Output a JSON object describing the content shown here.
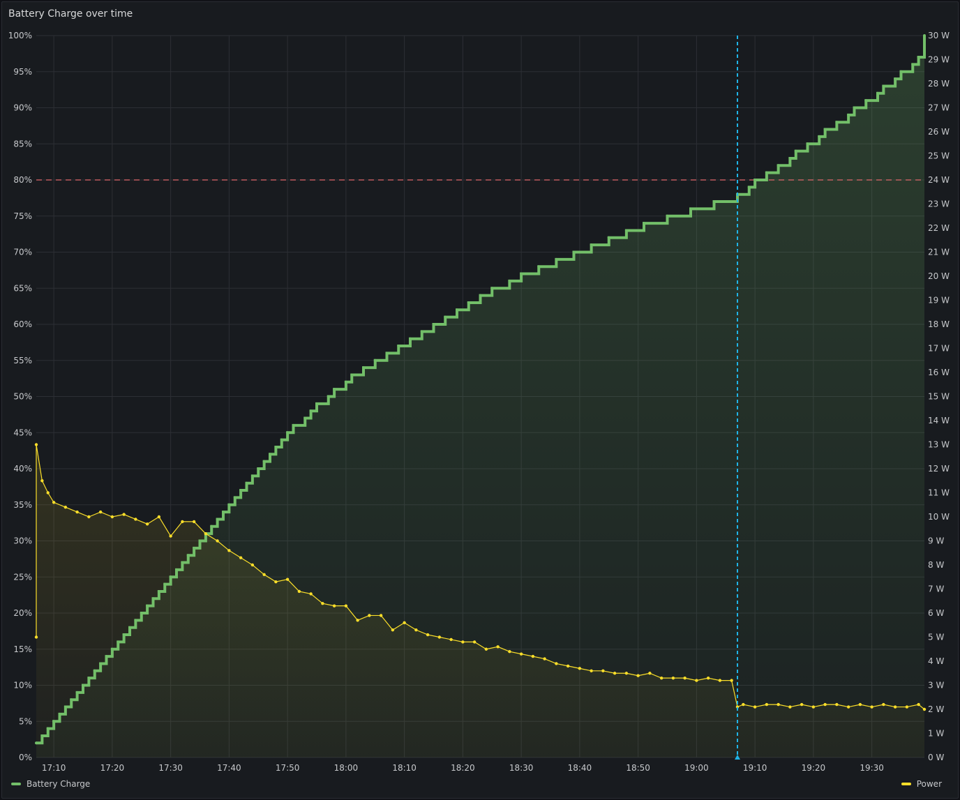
{
  "panel": {
    "title": "Battery Charge over time"
  },
  "colors": {
    "battery": "#73bf69",
    "power": "#fade2a",
    "threshold": "#e0676b",
    "cursor": "#1fb4e7",
    "grid": "#2c2f35"
  },
  "chart_data": {
    "type": "line",
    "title": "Battery Charge over time",
    "x_ticks": [
      "17:10",
      "17:20",
      "17:30",
      "17:40",
      "17:50",
      "18:00",
      "18:10",
      "18:20",
      "18:30",
      "18:40",
      "18:50",
      "19:00",
      "19:10",
      "19:20",
      "19:30"
    ],
    "x_range": [
      "17:07",
      "19:39"
    ],
    "y_left": {
      "unit": "%",
      "range": [
        0,
        100
      ],
      "ticks": [
        "0%",
        "5%",
        "10%",
        "15%",
        "20%",
        "25%",
        "30%",
        "35%",
        "40%",
        "45%",
        "50%",
        "55%",
        "60%",
        "65%",
        "70%",
        "75%",
        "80%",
        "85%",
        "90%",
        "95%",
        "100%"
      ]
    },
    "y_right": {
      "unit": "W",
      "range": [
        0,
        30
      ],
      "ticks": [
        "0 W",
        "1 W",
        "2 W",
        "3 W",
        "4 W",
        "5 W",
        "6 W",
        "7 W",
        "8 W",
        "9 W",
        "10 W",
        "11 W",
        "12 W",
        "13 W",
        "14 W",
        "15 W",
        "16 W",
        "17 W",
        "18 W",
        "19 W",
        "20 W",
        "21 W",
        "22 W",
        "23 W",
        "24 W",
        "25 W",
        "26 W",
        "27 W",
        "28 W",
        "29 W",
        "30 W"
      ]
    },
    "threshold": {
      "axis": "left",
      "value": 80,
      "style": "dashed"
    },
    "cursor_time": "19:07",
    "series": [
      {
        "name": "Battery Charge",
        "axis": "left",
        "interpolation": "step",
        "fill": true,
        "points": [
          [
            "17:07",
            2
          ],
          [
            "17:08",
            3
          ],
          [
            "17:09",
            4
          ],
          [
            "17:10",
            5
          ],
          [
            "17:11",
            6
          ],
          [
            "17:12",
            7
          ],
          [
            "17:13",
            8
          ],
          [
            "17:14",
            9
          ],
          [
            "17:15",
            10
          ],
          [
            "17:16",
            11
          ],
          [
            "17:17",
            12
          ],
          [
            "17:18",
            13
          ],
          [
            "17:19",
            14
          ],
          [
            "17:20",
            15
          ],
          [
            "17:21",
            16
          ],
          [
            "17:22",
            17
          ],
          [
            "17:23",
            18
          ],
          [
            "17:24",
            19
          ],
          [
            "17:25",
            20
          ],
          [
            "17:26",
            21
          ],
          [
            "17:27",
            22
          ],
          [
            "17:28",
            23
          ],
          [
            "17:29",
            24
          ],
          [
            "17:30",
            25
          ],
          [
            "17:31",
            26
          ],
          [
            "17:32",
            27
          ],
          [
            "17:33",
            28
          ],
          [
            "17:34",
            29
          ],
          [
            "17:35",
            30
          ],
          [
            "17:36",
            31
          ],
          [
            "17:37",
            32
          ],
          [
            "17:38",
            33
          ],
          [
            "17:39",
            34
          ],
          [
            "17:40",
            35
          ],
          [
            "17:41",
            36
          ],
          [
            "17:42",
            37
          ],
          [
            "17:43",
            38
          ],
          [
            "17:44",
            39
          ],
          [
            "17:45",
            40
          ],
          [
            "17:46",
            41
          ],
          [
            "17:47",
            42
          ],
          [
            "17:48",
            43
          ],
          [
            "17:49",
            44
          ],
          [
            "17:50",
            45
          ],
          [
            "17:51",
            46
          ],
          [
            "17:53",
            47
          ],
          [
            "17:54",
            48
          ],
          [
            "17:55",
            49
          ],
          [
            "17:57",
            50
          ],
          [
            "17:58",
            51
          ],
          [
            "18:00",
            52
          ],
          [
            "18:01",
            53
          ],
          [
            "18:03",
            54
          ],
          [
            "18:05",
            55
          ],
          [
            "18:07",
            56
          ],
          [
            "18:09",
            57
          ],
          [
            "18:11",
            58
          ],
          [
            "18:13",
            59
          ],
          [
            "18:15",
            60
          ],
          [
            "18:17",
            61
          ],
          [
            "18:19",
            62
          ],
          [
            "18:21",
            63
          ],
          [
            "18:23",
            64
          ],
          [
            "18:25",
            65
          ],
          [
            "18:28",
            66
          ],
          [
            "18:30",
            67
          ],
          [
            "18:33",
            68
          ],
          [
            "18:36",
            69
          ],
          [
            "18:39",
            70
          ],
          [
            "18:42",
            71
          ],
          [
            "18:45",
            72
          ],
          [
            "18:48",
            73
          ],
          [
            "18:51",
            74
          ],
          [
            "18:55",
            75
          ],
          [
            "18:59",
            76
          ],
          [
            "19:03",
            77
          ],
          [
            "19:07",
            78
          ],
          [
            "19:09",
            79
          ],
          [
            "19:10",
            80
          ],
          [
            "19:12",
            81
          ],
          [
            "19:14",
            82
          ],
          [
            "19:16",
            83
          ],
          [
            "19:17",
            84
          ],
          [
            "19:19",
            85
          ],
          [
            "19:21",
            86
          ],
          [
            "19:22",
            87
          ],
          [
            "19:24",
            88
          ],
          [
            "19:26",
            89
          ],
          [
            "19:27",
            90
          ],
          [
            "19:29",
            91
          ],
          [
            "19:31",
            92
          ],
          [
            "19:32",
            93
          ],
          [
            "19:34",
            94
          ],
          [
            "19:35",
            95
          ],
          [
            "19:37",
            96
          ],
          [
            "19:38",
            97
          ],
          [
            "19:39",
            98
          ],
          [
            "19:39",
            99
          ],
          [
            "19:39",
            100
          ]
        ]
      },
      {
        "name": "Power",
        "axis": "right",
        "interpolation": "linear",
        "fill": true,
        "points": [
          [
            "17:07",
            5.0
          ],
          [
            "17:07",
            13.0
          ],
          [
            "17:08",
            11.5
          ],
          [
            "17:09",
            11.0
          ],
          [
            "17:10",
            10.6
          ],
          [
            "17:12",
            10.4
          ],
          [
            "17:14",
            10.2
          ],
          [
            "17:16",
            10.0
          ],
          [
            "17:18",
            10.2
          ],
          [
            "17:20",
            10.0
          ],
          [
            "17:22",
            10.1
          ],
          [
            "17:24",
            9.9
          ],
          [
            "17:26",
            9.7
          ],
          [
            "17:28",
            10.0
          ],
          [
            "17:30",
            9.2
          ],
          [
            "17:32",
            9.8
          ],
          [
            "17:34",
            9.8
          ],
          [
            "17:36",
            9.3
          ],
          [
            "17:38",
            9.0
          ],
          [
            "17:40",
            8.6
          ],
          [
            "17:42",
            8.3
          ],
          [
            "17:44",
            8.0
          ],
          [
            "17:46",
            7.6
          ],
          [
            "17:48",
            7.3
          ],
          [
            "17:50",
            7.4
          ],
          [
            "17:52",
            6.9
          ],
          [
            "17:54",
            6.8
          ],
          [
            "17:56",
            6.4
          ],
          [
            "17:58",
            6.3
          ],
          [
            "18:00",
            6.3
          ],
          [
            "18:02",
            5.7
          ],
          [
            "18:04",
            5.9
          ],
          [
            "18:06",
            5.9
          ],
          [
            "18:08",
            5.3
          ],
          [
            "18:10",
            5.6
          ],
          [
            "18:12",
            5.3
          ],
          [
            "18:14",
            5.1
          ],
          [
            "18:16",
            5.0
          ],
          [
            "18:18",
            4.9
          ],
          [
            "18:20",
            4.8
          ],
          [
            "18:22",
            4.8
          ],
          [
            "18:24",
            4.5
          ],
          [
            "18:26",
            4.6
          ],
          [
            "18:28",
            4.4
          ],
          [
            "18:30",
            4.3
          ],
          [
            "18:32",
            4.2
          ],
          [
            "18:34",
            4.1
          ],
          [
            "18:36",
            3.9
          ],
          [
            "18:38",
            3.8
          ],
          [
            "18:40",
            3.7
          ],
          [
            "18:42",
            3.6
          ],
          [
            "18:44",
            3.6
          ],
          [
            "18:46",
            3.5
          ],
          [
            "18:48",
            3.5
          ],
          [
            "18:50",
            3.4
          ],
          [
            "18:52",
            3.5
          ],
          [
            "18:54",
            3.3
          ],
          [
            "18:56",
            3.3
          ],
          [
            "18:58",
            3.3
          ],
          [
            "19:00",
            3.2
          ],
          [
            "19:02",
            3.3
          ],
          [
            "19:04",
            3.2
          ],
          [
            "19:06",
            3.2
          ],
          [
            "19:07",
            2.1
          ],
          [
            "19:08",
            2.2
          ],
          [
            "19:10",
            2.1
          ],
          [
            "19:12",
            2.2
          ],
          [
            "19:14",
            2.2
          ],
          [
            "19:16",
            2.1
          ],
          [
            "19:18",
            2.2
          ],
          [
            "19:20",
            2.1
          ],
          [
            "19:22",
            2.2
          ],
          [
            "19:24",
            2.2
          ],
          [
            "19:26",
            2.1
          ],
          [
            "19:28",
            2.2
          ],
          [
            "19:30",
            2.1
          ],
          [
            "19:32",
            2.2
          ],
          [
            "19:34",
            2.1
          ],
          [
            "19:36",
            2.1
          ],
          [
            "19:38",
            2.2
          ],
          [
            "19:39",
            2.0
          ]
        ]
      }
    ],
    "legend": {
      "placement": "bottom",
      "items": [
        "Battery Charge",
        "Power"
      ]
    }
  }
}
